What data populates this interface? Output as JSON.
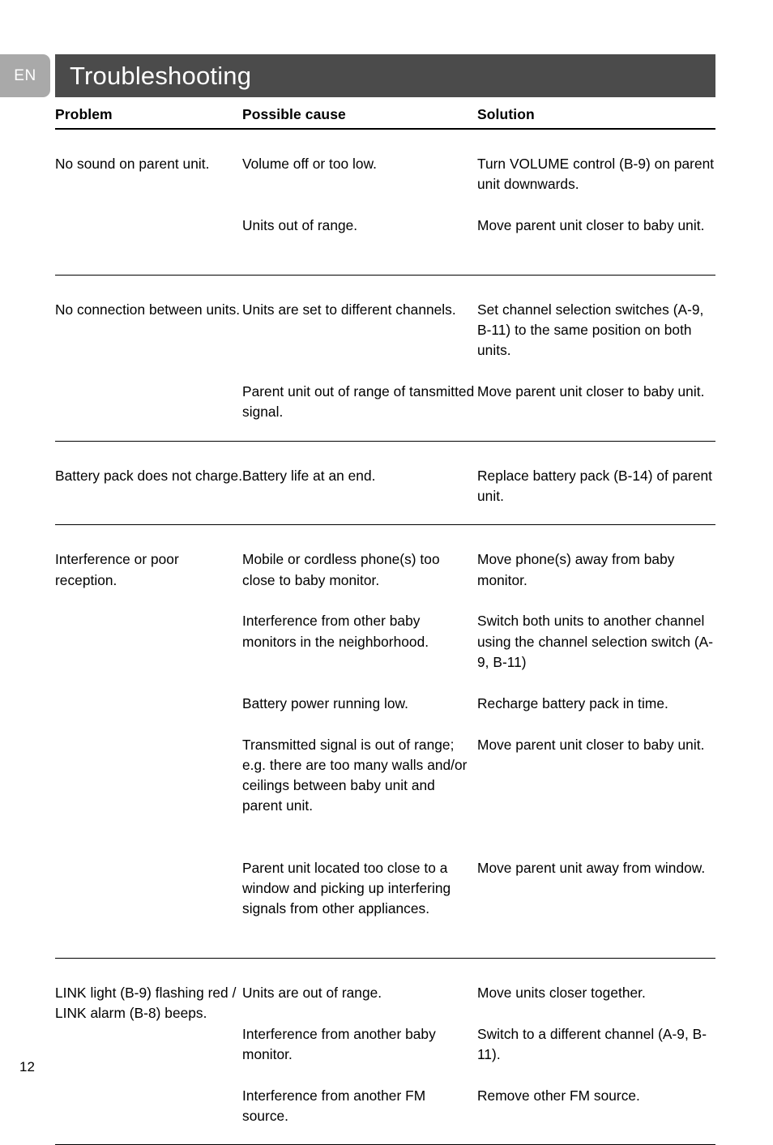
{
  "page": {
    "language_tab": "EN",
    "title": "Troubleshooting",
    "page_number": "12",
    "colors": {
      "title_bar": "#4b4b4b",
      "lang_tab": "#a9a9a9",
      "rule": "#000000",
      "text": "#000000"
    }
  },
  "table": {
    "headers": {
      "problem": "Problem",
      "cause": "Possible cause",
      "solution": "Solution"
    },
    "sections": [
      {
        "problem": "No sound on parent unit.",
        "rows": [
          {
            "cause": "Volume off or too low.",
            "solution": "Turn VOLUME control (B-9) on parent unit downwards."
          },
          {
            "cause": "Units out of range.",
            "solution": "Move parent unit closer to baby unit."
          }
        ]
      },
      {
        "problem": "No connection between units.",
        "rows": [
          {
            "cause": "Units are set to different channels.",
            "solution": "Set channel selection switches (A-9, B-11) to the same position on both units."
          },
          {
            "cause": "Parent unit out of range of tansmitted signal.",
            "solution": "Move parent unit closer to baby unit."
          }
        ]
      },
      {
        "problem": "Battery pack does not charge.",
        "rows": [
          {
            "cause": "Battery life at an end.",
            "solution": "Replace battery pack (B-14) of parent unit."
          }
        ]
      },
      {
        "problem": "Interference or poor reception.",
        "rows": [
          {
            "cause": "Mobile or cordless phone(s) too close to baby monitor.",
            "solution": "Move phone(s) away from baby monitor."
          },
          {
            "cause": "Interference from other baby monitors in the neighborhood.",
            "solution": "Switch both units to another channel using the channel selection switch (A-9, B-11)"
          },
          {
            "cause": "Battery power running low.",
            "solution": "Recharge battery pack in time."
          },
          {
            "cause": "Transmitted signal is out of range; e.g. there are too many walls and/or ceilings between baby unit and parent unit.",
            "solution": "Move parent unit closer to baby unit."
          },
          {
            "cause": "Parent unit located too close to a window and picking up interfering signals from other appliances.",
            "solution": "Move parent unit away from window."
          }
        ]
      },
      {
        "problem": "LINK light (B-9) flashing red / LINK alarm (B-8) beeps.",
        "rows": [
          {
            "cause": "Units are out of range.",
            "solution": "Move units closer together."
          },
          {
            "cause": "Interference from another baby monitor.",
            "solution": "Switch to a different channel (A-9, B-11)."
          },
          {
            "cause": "Interference from another FM source.",
            "solution": "Remove other FM source."
          }
        ]
      }
    ]
  }
}
